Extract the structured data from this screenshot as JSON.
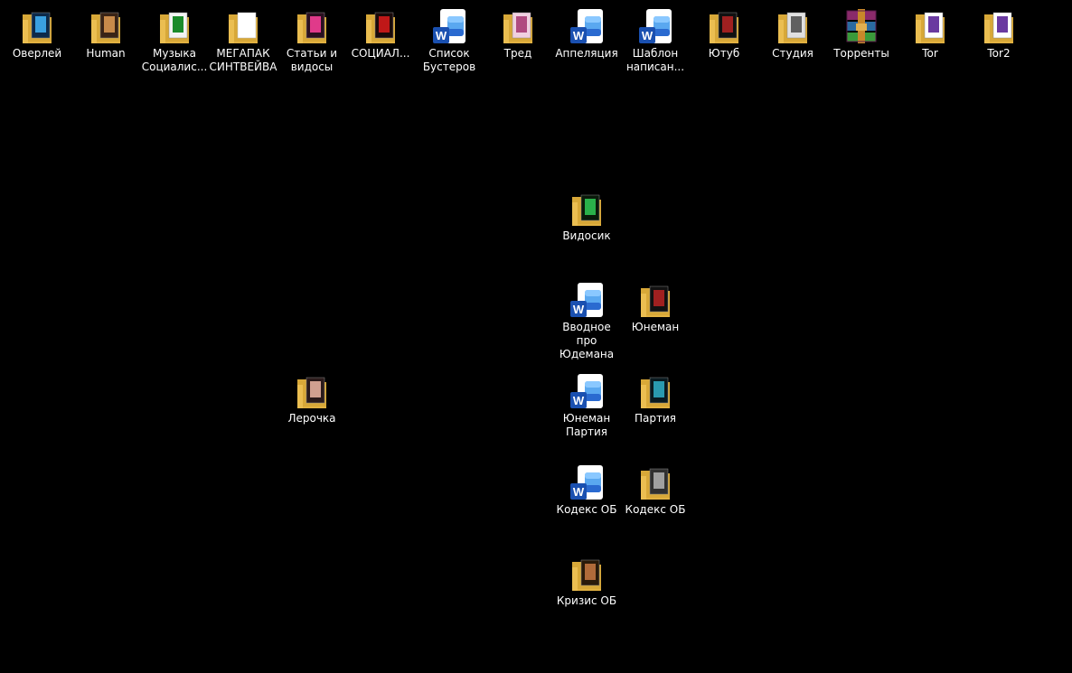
{
  "desktop": {
    "background_color": "#000000",
    "icons": [
      {
        "label": "Оверлей",
        "type": "folder",
        "icon_name": "folder-icon",
        "preview": "blue-dark"
      },
      {
        "label": "Human",
        "type": "folder",
        "icon_name": "folder-icon",
        "preview": "brown-photo"
      },
      {
        "label": "Музыка Социалис...",
        "type": "folder",
        "icon_name": "folder-icon",
        "preview": "white-grid"
      },
      {
        "label": "МЕГАПАК СИНТВЕЙВА",
        "type": "folder",
        "icon_name": "folder-icon",
        "preview": "empty"
      },
      {
        "label": "Статьи и видосы",
        "type": "folder",
        "icon_name": "folder-icon",
        "preview": "pink-photo"
      },
      {
        "label": "СОЦИАЛ...",
        "type": "folder",
        "icon_name": "folder-icon",
        "preview": "red-dark"
      },
      {
        "label": "Список Бустеров",
        "type": "word",
        "icon_name": "word-document-icon"
      },
      {
        "label": "Тред",
        "type": "folder",
        "icon_name": "folder-icon",
        "preview": "pink-light"
      },
      {
        "label": "Аппеляция",
        "type": "word",
        "icon_name": "word-document-icon"
      },
      {
        "label": "Шаблон написан...",
        "type": "word",
        "icon_name": "word-document-icon"
      },
      {
        "label": "Ютуб",
        "type": "folder",
        "icon_name": "folder-icon",
        "preview": "dark-red"
      },
      {
        "label": "Студия",
        "type": "folder",
        "icon_name": "folder-icon",
        "preview": "grey-sketch"
      },
      {
        "label": "Торренты",
        "type": "archive",
        "icon_name": "winrar-archive-icon"
      },
      {
        "label": "Tor",
        "type": "folder",
        "icon_name": "folder-icon",
        "preview": "tor-doc"
      },
      {
        "label": "Tor2",
        "type": "folder",
        "icon_name": "folder-icon",
        "preview": "tor-doc"
      },
      {
        "label": "Видосик",
        "type": "folder",
        "icon_name": "folder-icon",
        "preview": "green-photo"
      },
      {
        "label": "Вводное про Юдемана",
        "type": "word",
        "icon_name": "word-document-icon"
      },
      {
        "label": "Юнеман",
        "type": "folder",
        "icon_name": "folder-icon",
        "preview": "dark-red"
      },
      {
        "label": "Лерочка",
        "type": "folder",
        "icon_name": "folder-icon",
        "preview": "portrait"
      },
      {
        "label": "Юнеман Партия",
        "type": "word",
        "icon_name": "word-document-icon"
      },
      {
        "label": "Партия",
        "type": "folder",
        "icon_name": "folder-icon",
        "preview": "teal-dark"
      },
      {
        "label": "Кодекс ОБ",
        "type": "word",
        "icon_name": "word-document-icon"
      },
      {
        "label": "Кодекс ОБ",
        "type": "folder",
        "icon_name": "folder-icon",
        "preview": "grey-photo"
      },
      {
        "label": "Кризис ОБ",
        "type": "folder",
        "icon_name": "folder-icon",
        "preview": "brown-dark"
      }
    ]
  }
}
